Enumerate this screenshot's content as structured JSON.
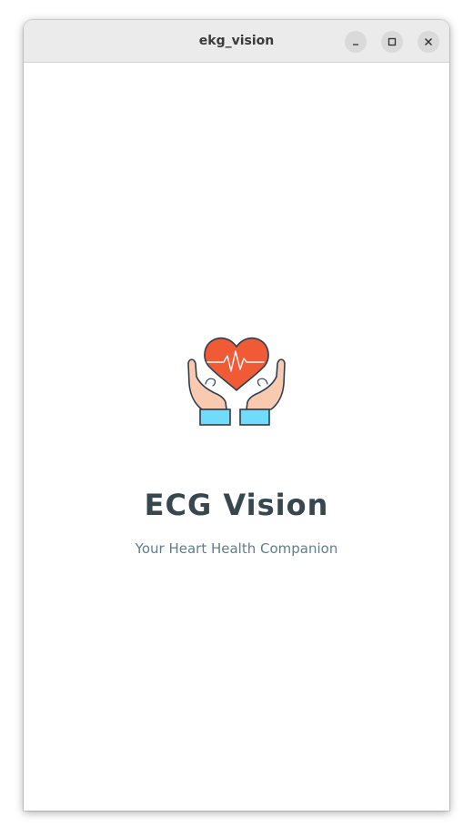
{
  "window": {
    "title": "ekg_vision"
  },
  "splash": {
    "logo_icon": "heart-hands-ekg-icon",
    "app_name": "ECG Vision",
    "tagline": "Your Heart Health Companion"
  },
  "colors": {
    "heart": "#f05a35",
    "skin": "#f9c9b0",
    "cuff": "#6fdcfb",
    "outline": "#2c3e50",
    "title_text": "#37474f",
    "subtitle_text": "#607d8b"
  }
}
